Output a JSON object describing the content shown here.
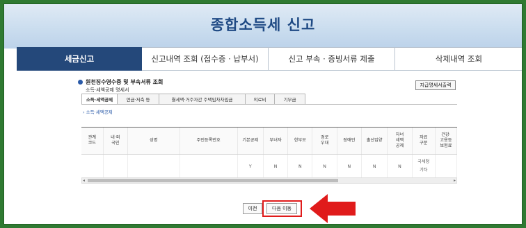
{
  "banner": {
    "title": "종합소득세 신고"
  },
  "main_tabs": [
    {
      "label": "세금신고",
      "active": true
    },
    {
      "label": "신고내역 조회 (접수증 · 납부서)",
      "active": false
    },
    {
      "label": "신고 부속 · 증빙서류 제출",
      "active": false
    },
    {
      "label": "삭제내역 조회",
      "active": false
    }
  ],
  "section": {
    "title": "원천징수영수증 및 부속서류 조회",
    "subtitle": "소득·세액공제 명세서",
    "print_label": "지급명세서출력"
  },
  "sub_tabs": [
    {
      "label": "소득·세액공제"
    },
    {
      "label": "연금·저축 등"
    },
    {
      "label": "월세액·거주자간 주택임차차입금"
    },
    {
      "label": "의료비"
    },
    {
      "label": "기부금"
    }
  ],
  "sub_link": "› 소득·세액공제",
  "table": {
    "headers": [
      "관계\n코드",
      "내·외\n국인",
      "성명",
      "주민등록번호",
      "기본공제",
      "부녀자",
      "한부모",
      "경로\n우대",
      "장애인",
      "출산입양",
      "자녀\n세액\n공제",
      "자료\n구분",
      "건강·\n고용등\n보험료"
    ],
    "row": [
      "",
      "",
      "",
      "",
      "Y",
      "N",
      "N",
      "N",
      "N",
      "N",
      "N",
      "",
      ""
    ],
    "data_source": [
      "국세청",
      "기타"
    ]
  },
  "buttons": {
    "prev": "이전",
    "next": "다음 이동"
  },
  "colors": {
    "active_tab": "#24487a",
    "highlight": "#e01b1b",
    "border_green": "#2f7a32"
  }
}
